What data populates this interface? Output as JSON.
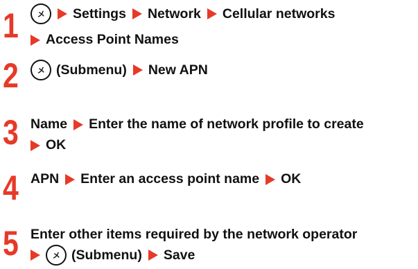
{
  "menu_key": "メニュー",
  "steps": [
    {
      "number": "1",
      "lines": [
        "Settings",
        "Network",
        "Cellular networks",
        "Access Point Names"
      ]
    },
    {
      "number": "2",
      "lines": [
        "(Submenu)",
        "New APN"
      ]
    },
    {
      "number": "3",
      "lines": [
        "Name",
        "Enter the name of network profile to create",
        "OK"
      ]
    },
    {
      "number": "4",
      "lines": [
        "APN",
        "Enter an access point name",
        "OK"
      ]
    },
    {
      "number": "5",
      "lines": [
        "Enter other items required by the network operator",
        "(Submenu)",
        "Save"
      ]
    }
  ]
}
